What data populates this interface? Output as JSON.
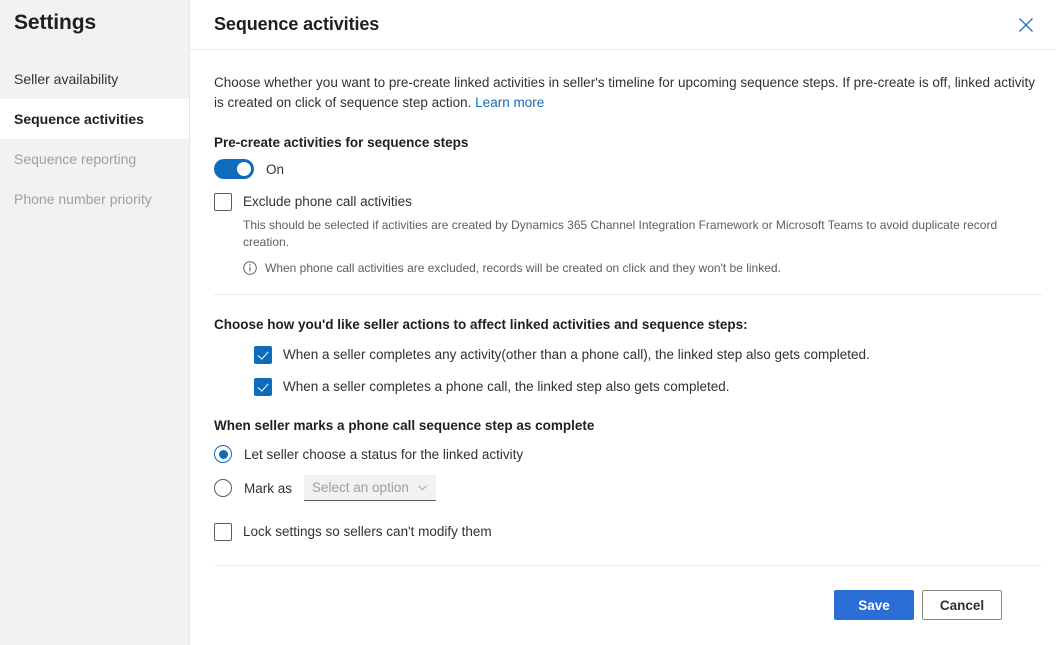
{
  "sidebar": {
    "title": "Settings",
    "items": [
      {
        "label": "Seller availability",
        "state": "normal"
      },
      {
        "label": "Sequence activities",
        "state": "selected"
      },
      {
        "label": "Sequence reporting",
        "state": "disabled"
      },
      {
        "label": "Phone number priority",
        "state": "disabled"
      }
    ]
  },
  "panel": {
    "title": "Sequence activities",
    "close_icon": "close-icon",
    "intro": {
      "text": "Choose whether you want to pre-create linked activities in seller's timeline for upcoming sequence steps. If pre-create is off, linked activity is created on click of sequence step action.",
      "link_label": "Learn more"
    },
    "precreate": {
      "label": "Pre-create activities for sequence steps",
      "toggle_state": "on",
      "toggle_label": "On",
      "exclude_checkbox": {
        "label": "Exclude phone call activities",
        "checked": false
      },
      "hint": "This should be selected if activities are created by Dynamics 365 Channel Integration Framework or Microsoft Teams to avoid duplicate record creation.",
      "note_icon": "info-circle-icon",
      "note": "When phone call activities are excluded, records will be created on click and they won't be linked."
    },
    "seller_actions": {
      "label": "Choose how you'd like seller actions to affect linked activities and sequence steps:",
      "options": [
        {
          "label": "When a seller completes any activity(other than a phone call), the linked step also gets completed.",
          "checked": true
        },
        {
          "label": "When a seller completes a phone call, the linked step also gets completed.",
          "checked": true
        }
      ]
    },
    "phone_complete": {
      "label": "When seller marks a phone call sequence step as complete",
      "options": [
        {
          "label": "Let seller choose a status for the linked activity",
          "selected": true
        },
        {
          "label": "Mark as",
          "selected": false
        }
      ],
      "dropdown": {
        "placeholder": "Select an option",
        "value": "Select an option",
        "chevron_icon": "chevron-down-icon"
      }
    },
    "lock": {
      "label": "Lock settings so sellers can't modify them",
      "checked": false
    },
    "footer": {
      "save_label": "Save",
      "cancel_label": "Cancel"
    }
  },
  "colors": {
    "accent": "#0f6cbd",
    "primary_button": "#2b6fd6",
    "link": "#0f6cbd",
    "sidebar_bg": "#f3f2f1"
  }
}
